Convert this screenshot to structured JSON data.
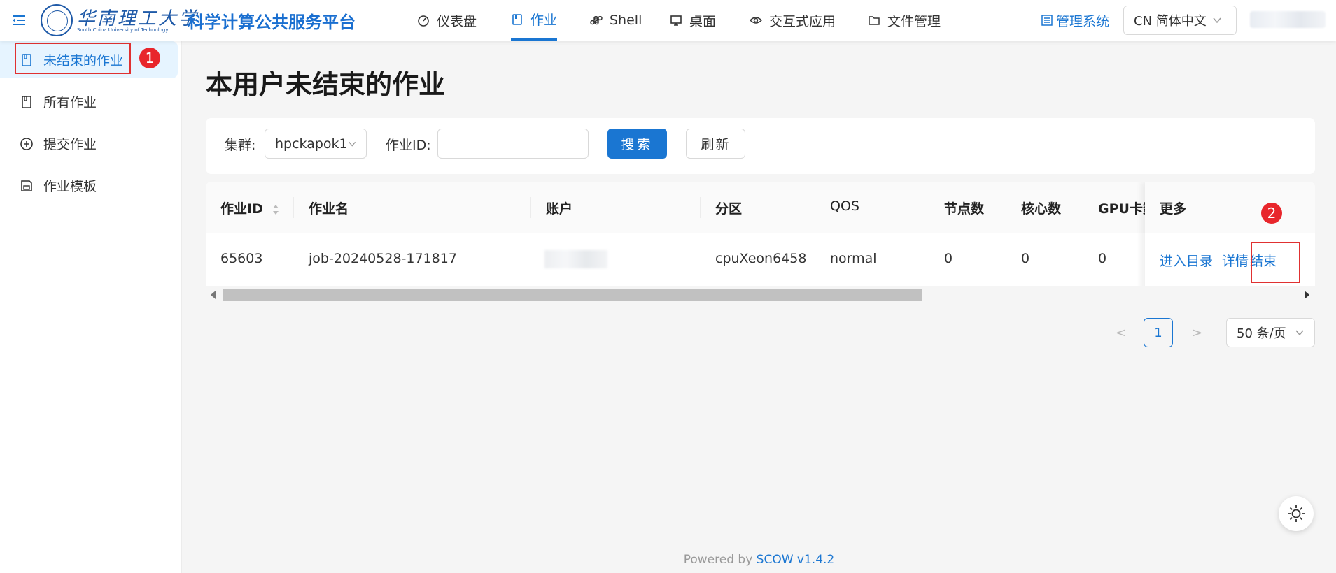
{
  "header": {
    "logo_cn": "华南理工大学",
    "logo_en": "South China University of Technology",
    "platform_title": "科学计算公共服务平台",
    "nav": [
      {
        "label": "仪表盘",
        "icon": "dashboard-icon"
      },
      {
        "label": "作业",
        "icon": "book-icon",
        "active": true
      },
      {
        "label": "Shell",
        "icon": "command-icon"
      },
      {
        "label": "桌面",
        "icon": "desktop-icon"
      },
      {
        "label": "交互式应用",
        "icon": "eye-icon"
      },
      {
        "label": "文件管理",
        "icon": "folder-icon"
      }
    ],
    "admin_link": "管理系统",
    "language": "CN 简体中文"
  },
  "sidebar": {
    "items": [
      {
        "label": "未结束的作业",
        "icon": "book-icon",
        "active": true
      },
      {
        "label": "所有作业",
        "icon": "book-icon"
      },
      {
        "label": "提交作业",
        "icon": "plus-circle-icon"
      },
      {
        "label": "作业模板",
        "icon": "save-icon"
      }
    ]
  },
  "annotations": {
    "badge_1": "1",
    "badge_2": "2"
  },
  "main": {
    "title": "本用户未结束的作业",
    "filter": {
      "cluster_label": "集群:",
      "cluster_value": "hpckapok1",
      "job_id_label": "作业ID:",
      "job_id_value": "",
      "search_button": "搜索",
      "refresh_button": "刷新"
    },
    "table": {
      "columns": [
        "作业ID",
        "作业名",
        "账户",
        "分区",
        "QOS",
        "节点数",
        "核心数",
        "GPU卡数",
        "更多"
      ],
      "rows": [
        {
          "job_id": "65603",
          "job_name": "job-20240528-171817",
          "account": "",
          "partition": "cpuXeon6458",
          "qos": "normal",
          "nodes": "0",
          "cores": "0",
          "gpus": "0",
          "actions": [
            "进入目录",
            "详情",
            "结束"
          ]
        }
      ]
    },
    "pagination": {
      "prev": "<",
      "current": "1",
      "next": ">",
      "page_size": "50 条/页"
    }
  },
  "footer": {
    "prefix": "Powered by",
    "link": "SCOW v1.4.2"
  },
  "colors": {
    "primary": "#1a76d2",
    "annotation": "#e03131"
  }
}
